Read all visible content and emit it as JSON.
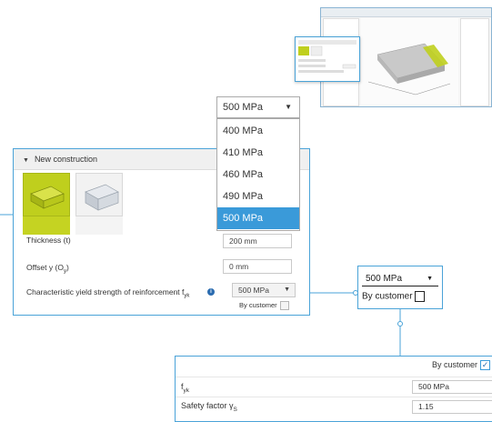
{
  "panel": {
    "header": "New construction",
    "thickness": {
      "label": "Thickness (t)",
      "value": "200 mm"
    },
    "offset": {
      "label": "Offset y (O",
      "label_sub": "y",
      "label_end": ")",
      "value": "0 mm"
    },
    "fyk": {
      "label": "Characteristic yield strength of reinforcement f",
      "label_sub": "yk",
      "value": "500 MPa",
      "by_customer": "By customer"
    }
  },
  "dropdown": {
    "selected": "500 MPa",
    "options": [
      "400 MPa",
      "410 MPa",
      "460 MPa",
      "490 MPa",
      "500 MPa"
    ]
  },
  "callout": {
    "value": "500 MPa",
    "by_customer": "By customer"
  },
  "bottom": {
    "by_customer": "By customer",
    "fyk_label": "f",
    "fyk_sub": "yk",
    "fyk_value": "500 MPa",
    "safety_label": "Safety factor γ",
    "safety_sub": "S",
    "safety_value": "1.15"
  },
  "colors": {
    "accent": "#4aa3d8",
    "selected": "#3a9ad9",
    "tile": "#bfcf1d"
  }
}
